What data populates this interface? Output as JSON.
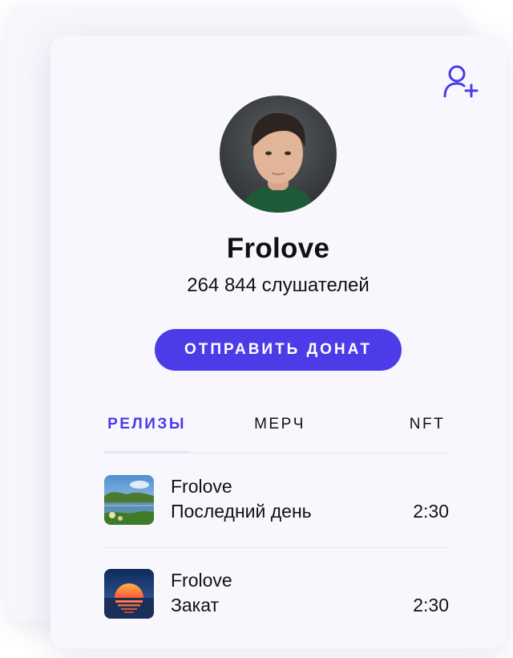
{
  "profile": {
    "name": "Frolove",
    "listeners": "264 844 слушателей",
    "donate_label": "ОТПРАВИТЬ ДОНАТ"
  },
  "tabs": [
    {
      "label": "РЕЛИЗЫ",
      "active": true
    },
    {
      "label": "МЕРЧ",
      "active": false
    },
    {
      "label": "NFT",
      "active": false
    }
  ],
  "tracks": [
    {
      "artist": "Frolove",
      "title": "Последний день",
      "duration": "2:30",
      "cover": "lake-landscape"
    },
    {
      "artist": "Frolove",
      "title": "Закат",
      "duration": "2:30",
      "cover": "sunset"
    }
  ],
  "icons": {
    "follow": "add-user-icon"
  },
  "colors": {
    "accent": "#4c3ce8",
    "text": "#111111",
    "card_bg": "#f8f7fd"
  }
}
